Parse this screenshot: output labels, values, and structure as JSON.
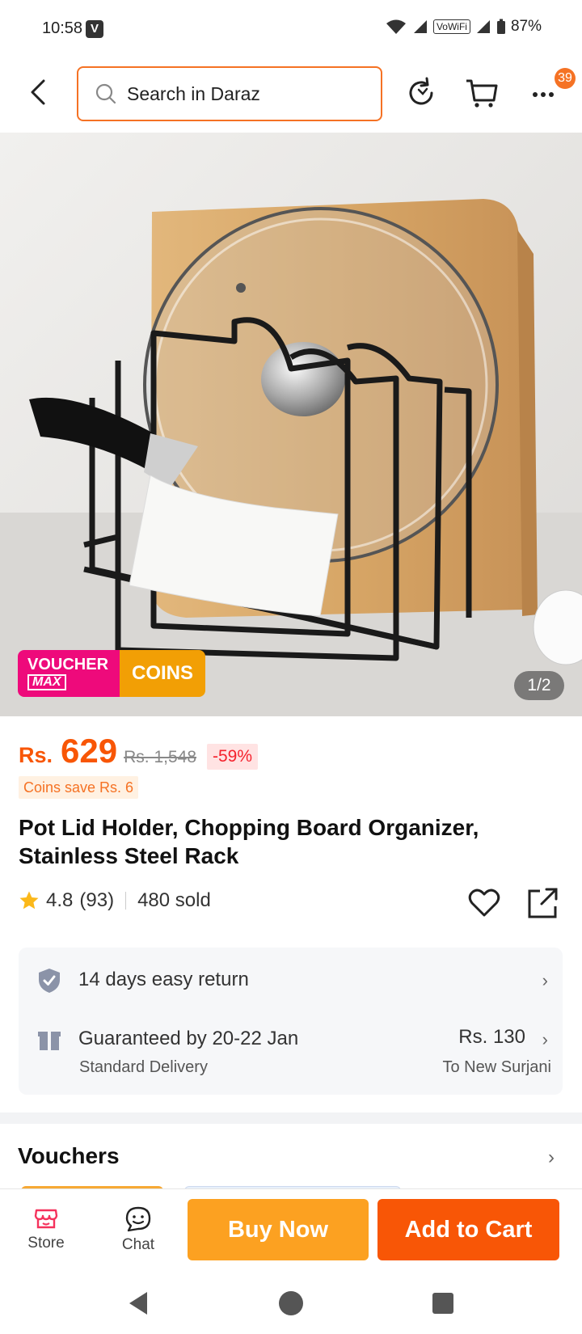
{
  "status_bar": {
    "time": "10:58",
    "carrier_badge": "V",
    "vowifi": "VoWiFi",
    "battery": "87%"
  },
  "header": {
    "search_placeholder": "Search in Daraz",
    "cart_count": "39"
  },
  "hero": {
    "voucher_label_top": "VOUCHER",
    "voucher_label_bottom": "MAX",
    "coins_label": "COINS",
    "image_counter": "1/2"
  },
  "price": {
    "currency": "Rs.",
    "current": "629",
    "original": "Rs. 1,548",
    "discount": "-59%",
    "coins_save": "Coins save Rs. 6"
  },
  "product": {
    "title": "Pot Lid Holder, Chopping Board Organizer, Stainless Steel Rack",
    "rating": "4.8",
    "reviews": "(93)",
    "sold": "480 sold"
  },
  "service": {
    "return_text": "14 days easy return",
    "delivery_text": "Guaranteed by 20-22 Jan",
    "delivery_type": "Standard Delivery",
    "shipping_fee": "Rs. 130",
    "ship_to": "To New Surjani"
  },
  "vouchers": {
    "title": "Vouchers"
  },
  "bottom_bar": {
    "store_label": "Store",
    "chat_label": "Chat",
    "buy_now_label": "Buy Now",
    "add_to_cart_label": "Add to Cart"
  },
  "colors": {
    "accent": "#f85606",
    "buy_now": "#fca121",
    "voucher_pink": "#ee0a7b",
    "coins_gold": "#f29f05"
  },
  "icons": [
    "back-arrow-icon",
    "search-icon",
    "history-icon",
    "cart-icon",
    "more-icon",
    "shield-check-icon",
    "gift-box-icon",
    "heart-icon",
    "share-icon",
    "store-icon",
    "chat-icon"
  ]
}
